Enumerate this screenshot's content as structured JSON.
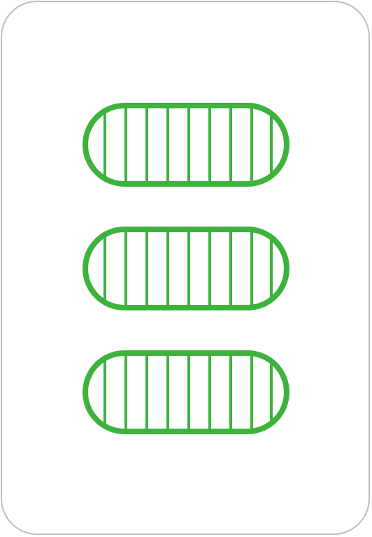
{
  "card": {
    "count": 3,
    "shape": "oval",
    "shading": "striped",
    "color": "#3db33d",
    "border_color": "#bdbdbd",
    "background_color": "#ffffff"
  }
}
